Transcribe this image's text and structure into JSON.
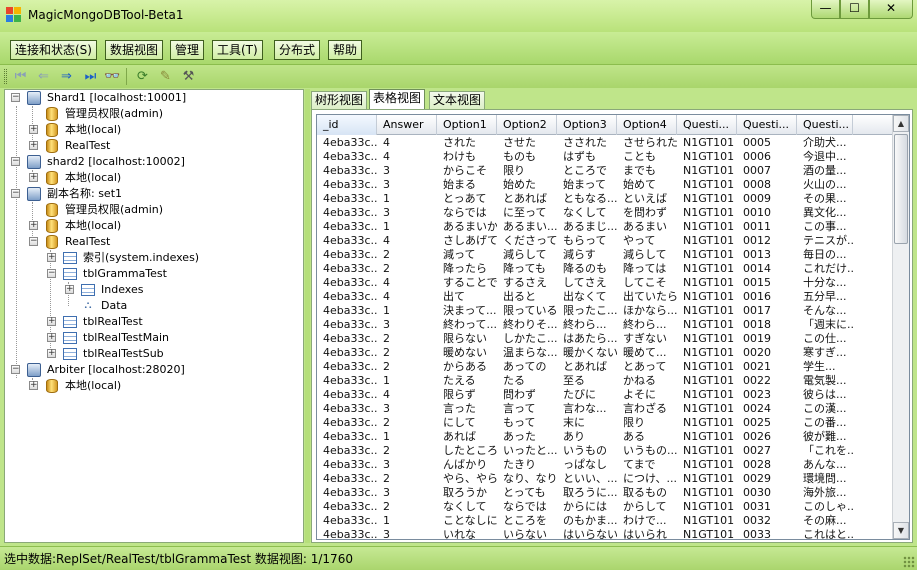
{
  "window": {
    "title": "MagicMongoDBTool-Beta1",
    "min": "—",
    "max": "☐",
    "close": "✕"
  },
  "menu": [
    "连接和状态(S)",
    "数据视图",
    "管理",
    "工具(T)",
    "分布式",
    "帮助"
  ],
  "toolbar": {
    "icons": [
      "first-page-icon",
      "prev-page-icon",
      "next-page-icon",
      "last-page-icon",
      "search-icon",
      "refresh-icon",
      "edit-icon",
      "settings-icon"
    ]
  },
  "tree": [
    {
      "label": "Shard1 [localhost:10001]",
      "icon": "server",
      "expander": "−"
    },
    {
      "label": "管理员权限(admin)",
      "icon": "db",
      "expander": ""
    },
    {
      "label": "本地(local)",
      "icon": "db",
      "expander": "+"
    },
    {
      "label": "RealTest",
      "icon": "db",
      "expander": "+"
    },
    {
      "label": "shard2 [localhost:10002]",
      "icon": "server",
      "expander": "−"
    },
    {
      "label": "本地(local)",
      "icon": "db",
      "expander": "+"
    },
    {
      "label": "副本名称: set1",
      "icon": "server",
      "expander": "−"
    },
    {
      "label": "管理员权限(admin)",
      "icon": "db",
      "expander": ""
    },
    {
      "label": "本地(local)",
      "icon": "db",
      "expander": "+"
    },
    {
      "label": "RealTest",
      "icon": "db",
      "expander": "−"
    },
    {
      "label": "索引(system.indexes)",
      "icon": "table",
      "expander": "+"
    },
    {
      "label": "tblGrammaTest",
      "icon": "table",
      "expander": "−"
    },
    {
      "label": "Indexes",
      "icon": "table",
      "expander": "+"
    },
    {
      "label": "Data",
      "icon": "data",
      "expander": ""
    },
    {
      "label": "tblRealTest",
      "icon": "table",
      "expander": "+"
    },
    {
      "label": "tblRealTestMain",
      "icon": "table",
      "expander": "+"
    },
    {
      "label": "tblRealTestSub",
      "icon": "table",
      "expander": "+"
    },
    {
      "label": "Arbiter [localhost:28020]",
      "icon": "server",
      "expander": "−"
    },
    {
      "label": "本地(local)",
      "icon": "db",
      "expander": "+"
    }
  ],
  "tabs": [
    "树形视图",
    "表格视图",
    "文本视图"
  ],
  "active_tab": 1,
  "grid": {
    "columns": [
      "_id",
      "Answer",
      "Option1",
      "Option2",
      "Option3",
      "Option4",
      "Questi...",
      "Questi...",
      "Questi..."
    ],
    "rows": [
      [
        "4eba33c...",
        "4",
        "された",
        "させた",
        "さされた",
        "させられた",
        "N1GT101",
        "0005",
        "介助犬..."
      ],
      [
        "4eba33c...",
        "4",
        "わけも",
        "ものも",
        "はずも",
        "ことも",
        "N1GT101",
        "0006",
        "今退中..."
      ],
      [
        "4eba33c...",
        "3",
        "からこそ",
        "限り",
        "ところで",
        "までも",
        "N1GT101",
        "0007",
        "酒の量..."
      ],
      [
        "4eba33c...",
        "3",
        "始まる",
        "始めた",
        "始まって",
        "始めて",
        "N1GT101",
        "0008",
        "火山の..."
      ],
      [
        "4eba33c...",
        "1",
        "とっあて",
        "とあれば",
        "ともなる...",
        "といえば",
        "N1GT101",
        "0009",
        "その果..."
      ],
      [
        "4eba33c...",
        "3",
        "ならでは",
        "に至って",
        "なくして",
        "を問わず",
        "N1GT101",
        "0010",
        "異文化..."
      ],
      [
        "4eba33c...",
        "1",
        "あるまいか",
        "あるまい...",
        "あるまじ...",
        "あるまい",
        "N1GT101",
        "0011",
        "この事..."
      ],
      [
        "4eba33c...",
        "4",
        "さしあげて",
        "くださって",
        "もらって",
        "やって",
        "N1GT101",
        "0012",
        "テニスが..."
      ],
      [
        "4eba33c...",
        "2",
        "減って",
        "減らして",
        "減らす",
        "減らして",
        "N1GT101",
        "0013",
        "毎日の..."
      ],
      [
        "4eba33c...",
        "2",
        "降ったら",
        "降っても",
        "降るのも",
        "降っては",
        "N1GT101",
        "0014",
        "これだけ..."
      ],
      [
        "4eba33c...",
        "4",
        "することで",
        "するさえ",
        "してさえ",
        "してこそ",
        "N1GT101",
        "0015",
        "十分な..."
      ],
      [
        "4eba33c...",
        "4",
        "出て",
        "出ると",
        "出なくて",
        "出ていたら",
        "N1GT101",
        "0016",
        "五分早..."
      ],
      [
        "4eba33c...",
        "1",
        "決まって...",
        "限っている",
        "限ったこ...",
        "ほかなら...",
        "N1GT101",
        "0017",
        "そんな..."
      ],
      [
        "4eba33c...",
        "3",
        "終わって...",
        "終わりそ...",
        "終わら...",
        "終わら...",
        "N1GT101",
        "0018",
        "「週末に..."
      ],
      [
        "4eba33c...",
        "2",
        "限らない",
        "しかたこ...",
        "はあたら...",
        "すぎない",
        "N1GT101",
        "0019",
        "この仕..."
      ],
      [
        "4eba33c...",
        "2",
        "暖めない",
        "温まらな...",
        "暖かくない",
        "暖めて...",
        "N1GT101",
        "0020",
        "寒すぎ..."
      ],
      [
        "4eba33c...",
        "2",
        "からある",
        "あっての",
        "とあれば",
        "とあって",
        "N1GT101",
        "0021",
        "学生..."
      ],
      [
        "4eba33c...",
        "1",
        "たえる",
        "たる",
        "至る",
        "かねる",
        "N1GT101",
        "0022",
        "電気製..."
      ],
      [
        "4eba33c...",
        "4",
        "限らず",
        "問わず",
        "たびに",
        "よそに",
        "N1GT101",
        "0023",
        "彼らは..."
      ],
      [
        "4eba33c...",
        "3",
        "言った",
        "言って",
        "言わな...",
        "言わざる",
        "N1GT101",
        "0024",
        "この漢..."
      ],
      [
        "4eba33c...",
        "2",
        "にして",
        "もって",
        "末に",
        "限り",
        "N1GT101",
        "0025",
        "この番..."
      ],
      [
        "4eba33c...",
        "1",
        "あれば",
        "あった",
        "あり",
        "ある",
        "N1GT101",
        "0026",
        "彼が難..."
      ],
      [
        "4eba33c...",
        "2",
        "したところ",
        "いったと...",
        "いうもの",
        "いうもの...",
        "N1GT101",
        "0027",
        "「これを..."
      ],
      [
        "4eba33c...",
        "3",
        "んばかり",
        "たきり",
        "っぱなし",
        "てまで",
        "N1GT101",
        "0028",
        "あんな..."
      ],
      [
        "4eba33c...",
        "2",
        "やら、やら",
        "なり、なり",
        "といい、...",
        "につけ、...",
        "N1GT101",
        "0029",
        "環境問..."
      ],
      [
        "4eba33c...",
        "3",
        "取ろうか",
        "とっても",
        "取ろうに...",
        "取るもの",
        "N1GT101",
        "0030",
        "海外旅..."
      ],
      [
        "4eba33c...",
        "2",
        "なくして",
        "ならでは",
        "からには",
        "からして",
        "N1GT101",
        "0031",
        "このしゃ..."
      ],
      [
        "4eba33c...",
        "1",
        "ことなしに",
        "ところを",
        "のもかま...",
        "わけで...",
        "N1GT101",
        "0032",
        "その麻..."
      ],
      [
        "4eba33c...",
        "3",
        "いれな",
        "いらない",
        "はいらない",
        "はいられ",
        "N1GT101",
        "0033",
        "これはと..."
      ]
    ]
  },
  "status": {
    "text": "选中数据:ReplSet/RealTest/tblGrammaTest  数据视图: 1/1760"
  },
  "colors": {
    "theme_green": "#bfe58a",
    "toolbar_green": "#a9d56b"
  }
}
